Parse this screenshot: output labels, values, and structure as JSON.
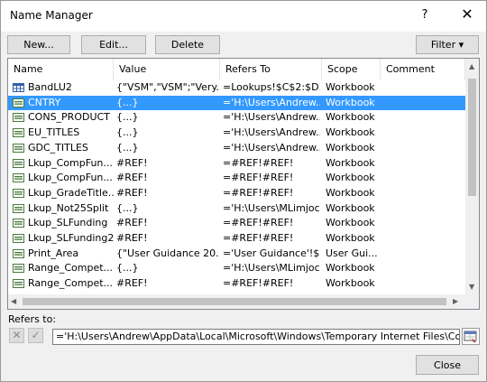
{
  "window": {
    "title": "Name Manager",
    "help_glyph": "?",
    "close_glyph": "✕"
  },
  "toolbar": {
    "new_label": "New...",
    "edit_label": "Edit...",
    "delete_label": "Delete",
    "filter_label": "Filter ▾"
  },
  "columns": {
    "name": "Name",
    "value": "Value",
    "refers_to": "Refers To",
    "scope": "Scope",
    "comment": "Comment"
  },
  "rows": [
    {
      "icon": "table-icon",
      "name": "BandLU2",
      "value": "{\"VSM\",\"VSM\";\"Very...",
      "refers": "=Lookups!$C$2:$D...",
      "scope": "Workbook",
      "selected": false
    },
    {
      "icon": "named-range-icon",
      "name": "CNTRY",
      "value": "{...}",
      "refers": "='H:\\Users\\Andrew...",
      "scope": "Workbook",
      "selected": true
    },
    {
      "icon": "named-range-icon",
      "name": "CONS_PRODUCT",
      "value": "{...}",
      "refers": "='H:\\Users\\Andrew...",
      "scope": "Workbook",
      "selected": false
    },
    {
      "icon": "named-range-icon",
      "name": "EU_TITLES",
      "value": "{...}",
      "refers": "='H:\\Users\\Andrew...",
      "scope": "Workbook",
      "selected": false
    },
    {
      "icon": "named-range-icon",
      "name": "GDC_TITLES",
      "value": "{...}",
      "refers": "='H:\\Users\\Andrew...",
      "scope": "Workbook",
      "selected": false
    },
    {
      "icon": "named-range-icon",
      "name": "Lkup_CompFun...",
      "value": "#REF!",
      "refers": "=#REF!#REF!",
      "scope": "Workbook",
      "selected": false
    },
    {
      "icon": "named-range-icon",
      "name": "Lkup_CompFun...",
      "value": "#REF!",
      "refers": "=#REF!#REF!",
      "scope": "Workbook",
      "selected": false
    },
    {
      "icon": "named-range-icon",
      "name": "Lkup_GradeTitle...",
      "value": "#REF!",
      "refers": "=#REF!#REF!",
      "scope": "Workbook",
      "selected": false
    },
    {
      "icon": "named-range-icon",
      "name": "Lkup_Not25Split",
      "value": "{...}",
      "refers": "='H:\\Users\\MLimjoc...",
      "scope": "Workbook",
      "selected": false
    },
    {
      "icon": "named-range-icon",
      "name": "Lkup_SLFunding",
      "value": "#REF!",
      "refers": "=#REF!#REF!",
      "scope": "Workbook",
      "selected": false
    },
    {
      "icon": "named-range-icon",
      "name": "Lkup_SLFunding2",
      "value": "#REF!",
      "refers": "=#REF!#REF!",
      "scope": "Workbook",
      "selected": false
    },
    {
      "icon": "named-range-icon",
      "name": "Print_Area",
      "value": "{\"User Guidance 20...",
      "refers": "='User Guidance'!$...",
      "scope": "User Gui...",
      "selected": false
    },
    {
      "icon": "named-range-icon",
      "name": "Range_Compet...",
      "value": "{...}",
      "refers": "='H:\\Users\\MLimjoc...",
      "scope": "Workbook",
      "selected": false
    },
    {
      "icon": "named-range-icon",
      "name": "Range_Compet...",
      "value": "#REF!",
      "refers": "=#REF!#REF!",
      "scope": "Workbook",
      "selected": false
    }
  ],
  "refers_to": {
    "label": "Refers to:",
    "value": "='H:\\Users\\Andrew\\AppData\\Local\\Microsoft\\Windows\\Temporary Internet Files\\Content.Outlo",
    "cancel_glyph": "✕",
    "confirm_glyph": "✓"
  },
  "footer": {
    "close_label": "Close"
  }
}
